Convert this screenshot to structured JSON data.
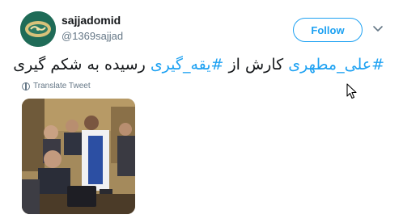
{
  "user": {
    "name": "sajjadomid",
    "handle": "@1369sajjad"
  },
  "actions": {
    "follow_label": "Follow"
  },
  "tweet": {
    "hashtag1": "#علی_مطهری",
    "text_mid": " کارش از ",
    "hashtag2": "#یقه_گیری",
    "text_end": " رسیده به شکم گیری",
    "translate_label": "Translate Tweet"
  },
  "colors": {
    "accent": "#1da1f2",
    "text": "#14171a",
    "secondary": "#657786"
  },
  "icons": {
    "caret": "chevron-down-icon",
    "translate": "globe-icon",
    "cursor": "mouse-pointer-icon"
  }
}
